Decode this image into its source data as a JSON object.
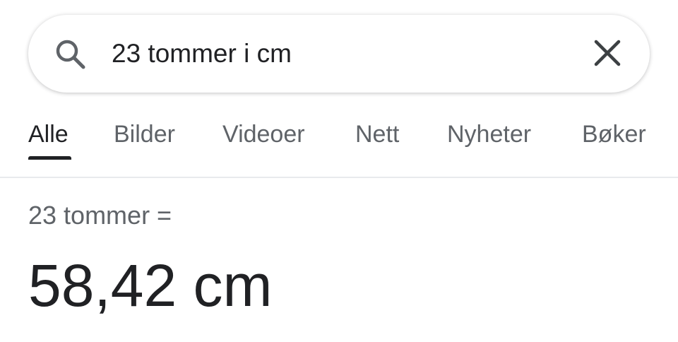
{
  "search": {
    "query": "23 tommer i cm",
    "search_icon": "search-icon",
    "clear_icon": "close-icon"
  },
  "tabs": [
    {
      "label": "Alle",
      "active": true
    },
    {
      "label": "Bilder",
      "active": false
    },
    {
      "label": "Videoer",
      "active": false
    },
    {
      "label": "Nett",
      "active": false
    },
    {
      "label": "Nyheter",
      "active": false
    },
    {
      "label": "Bøker",
      "active": false
    }
  ],
  "result": {
    "input_label": "23 tommer =",
    "output_value": "58,42 cm"
  },
  "colors": {
    "text_primary": "#202124",
    "text_secondary": "#5f6368",
    "divider": "#e8eaed"
  }
}
